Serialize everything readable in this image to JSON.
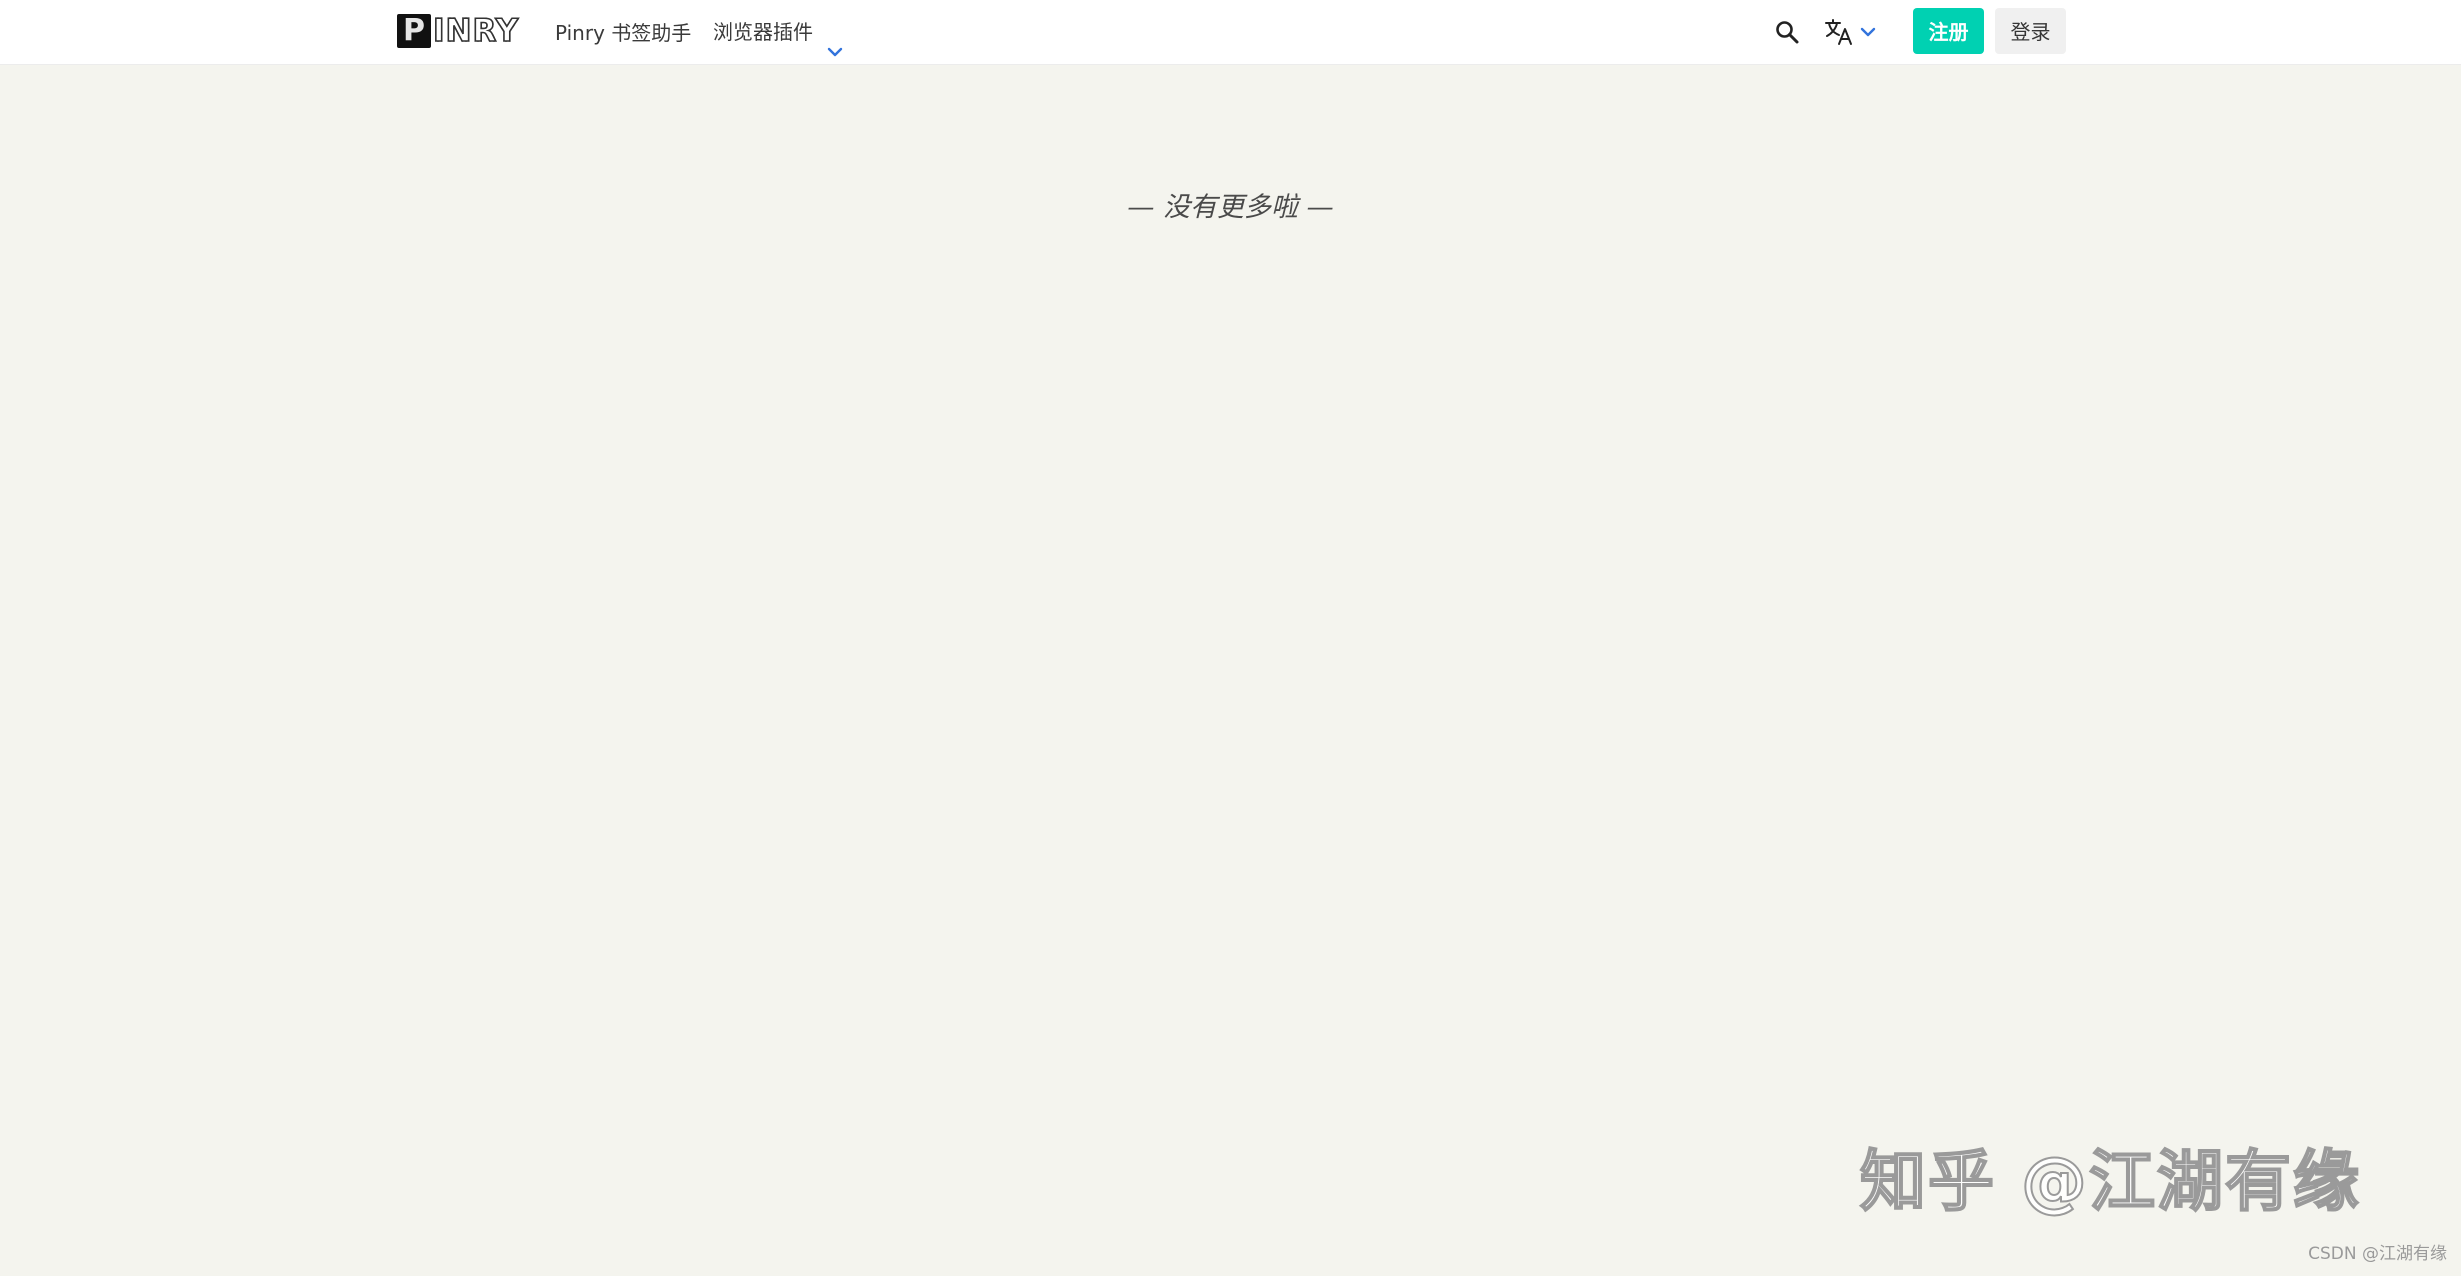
{
  "brand": {
    "logo_initial": "P",
    "logo_rest": "INRY"
  },
  "nav": {
    "bookmark_helper": "Pinry 书签助手",
    "browser_plugin": "浏览器插件"
  },
  "toolbar": {
    "signup_label": "注册",
    "login_label": "登录"
  },
  "icons": {
    "search": "search-icon",
    "language": "translate-icon",
    "dropdown": "chevron-down-icon"
  },
  "main": {
    "end_message": "— 没有更多啦 —"
  },
  "watermark": {
    "text": "知乎 @江湖有缘"
  },
  "footer": {
    "csdn_credit": "CSDN @江湖有缘"
  },
  "colors": {
    "accent": "#00d1b2",
    "link_blue": "#3273dc",
    "page_bg": "#f4f4ee"
  }
}
